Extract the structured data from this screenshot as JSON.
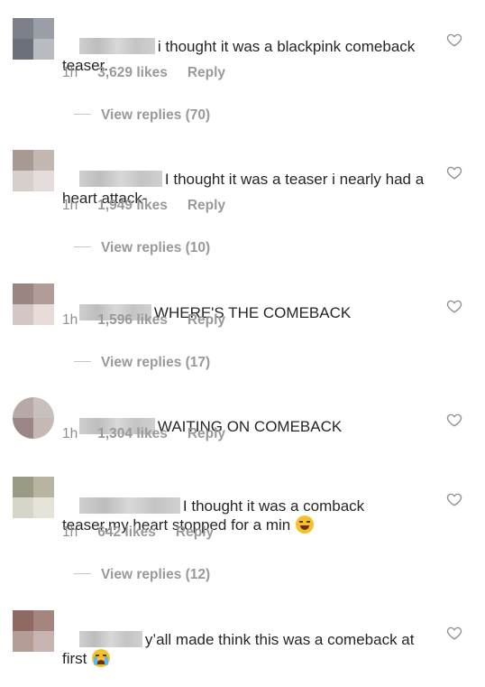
{
  "colors": {
    "text": "#262626",
    "meta": "#8e8e8e",
    "heart_outline": "#8e8e8e"
  },
  "comments": [
    {
      "text": "i thought it was a blackpink comeback teaser..",
      "time": "1h",
      "likes": "3,629 likes",
      "reply": "Reply",
      "view_replies": "View replies (70)",
      "icon": "heart-outline-icon"
    },
    {
      "text": "I thought it was a teaser i nearly had a heart attack-",
      "time": "1h",
      "likes": "1,949 likes",
      "reply": "Reply",
      "view_replies": "View replies (10)",
      "icon": "heart-outline-icon"
    },
    {
      "text": "WHERE'S THE COMEBACK",
      "time": "1h",
      "likes": "1,596 likes",
      "reply": "Reply",
      "view_replies": "View replies (17)",
      "icon": "heart-outline-icon"
    },
    {
      "text": "WAITING ON COMEBACK",
      "time": "1h",
      "likes": "1,304 likes",
      "reply": "Reply",
      "icon": "heart-outline-icon"
    },
    {
      "text": "I thought it was a comback teaser,my heart stopped for a min",
      "emoji": "grinning-sweat-emoji",
      "time": "1h",
      "likes": "642 likes",
      "reply": "Reply",
      "view_replies": "View replies (12)",
      "icon": "heart-outline-icon"
    },
    {
      "text": "y’all made think this was a comeback at first",
      "emoji": "crying-face-emoji",
      "icon": "heart-outline-icon"
    }
  ]
}
